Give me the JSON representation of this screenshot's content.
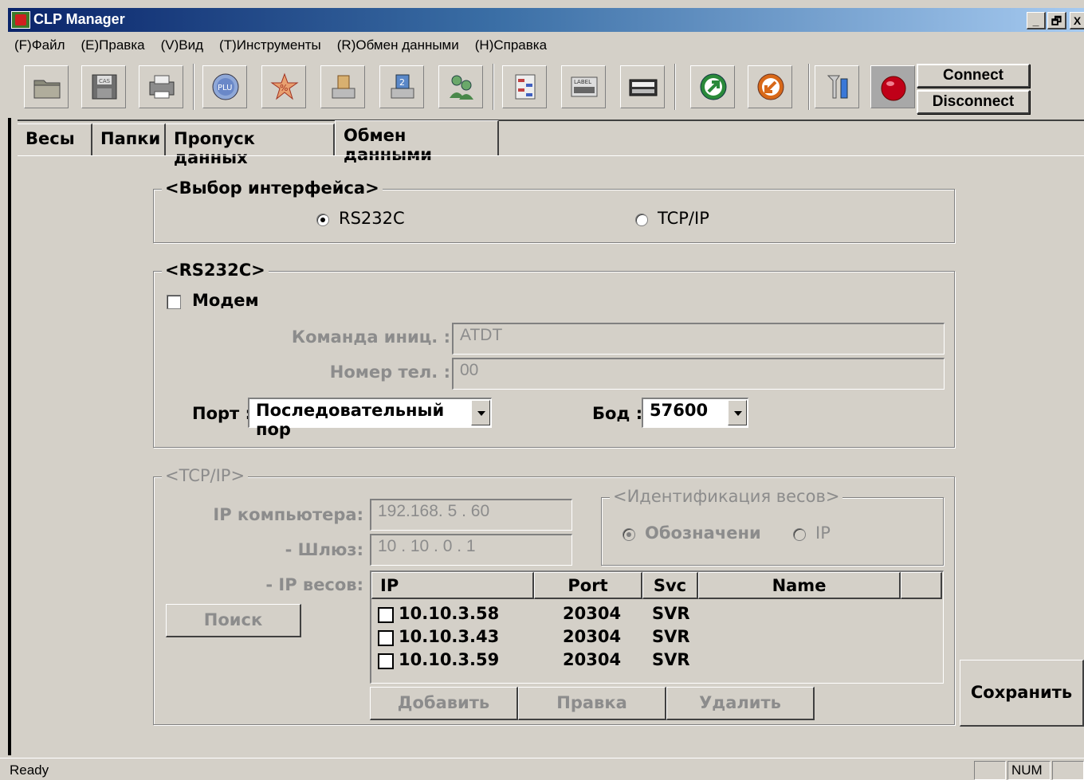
{
  "window": {
    "title": "CLP Manager",
    "controls": [
      "_",
      "🗗",
      "X"
    ]
  },
  "menu": [
    "(F)Файл",
    "(E)Правка",
    "(V)Вид",
    "(T)Инструменты",
    "(R)Обмен данными",
    "(H)Справка"
  ],
  "toolbar": {
    "connect": "Connect",
    "disconnect": "Disconnect",
    "icons": {
      "cas": "CAS",
      "plu": "PLU",
      "percent": "%",
      "two": "2",
      "label": "LABEL"
    }
  },
  "tabs": [
    "Весы",
    "Папки",
    "Пропуск данных",
    "Обмен данными"
  ],
  "interface": {
    "legend": "<Выбор интерфейса>",
    "rs232": "RS232C",
    "tcpip": "TCP/IP"
  },
  "rs232": {
    "legend": "<RS232C>",
    "modem": "Модем",
    "init_label": "Команда иниц. :",
    "init_value": "ATDT",
    "phone_label": "Номер тел. :",
    "phone_value": "00",
    "port_label": "Порт :",
    "port_value": "Последовательный пор",
    "baud_label": "Бод :",
    "baud_value": "57600"
  },
  "tcp": {
    "legend": "<TCP/IP>",
    "pc_ip_label": "IP компьютера:",
    "pc_ip_value": "192.168. 5 . 60",
    "gateway_label": "- Шлюз:",
    "gateway_value": "10 . 10 . 0 . 1",
    "scale_ip_label": "- IP весов:",
    "search": "Поиск",
    "ident": {
      "legend": "<Идентификация весов>",
      "opt1": "Обозначени",
      "opt2": "IP"
    },
    "columns": [
      "IP",
      "Port",
      "Svc",
      "Name"
    ],
    "rows": [
      {
        "ip": "10.10.3.58",
        "port": "20304",
        "svc": "SVR",
        "name": ""
      },
      {
        "ip": "10.10.3.43",
        "port": "20304",
        "svc": "SVR",
        "name": ""
      },
      {
        "ip": "10.10.3.59",
        "port": "20304",
        "svc": "SVR",
        "name": ""
      }
    ],
    "add": "Добавить",
    "edit": "Правка",
    "delete": "Удалить"
  },
  "save": "Сохранить",
  "status": {
    "text": "Ready",
    "num": "NUM"
  }
}
